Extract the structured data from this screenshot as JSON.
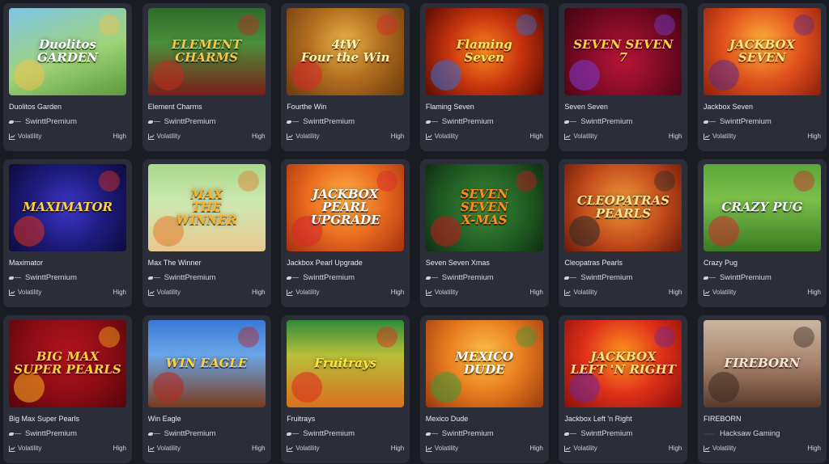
{
  "games": [
    {
      "name": "Duolitos Garden",
      "provider": "SwinttPremium",
      "volatility_label": "Volatility",
      "volatility": "High",
      "art_text": "Duolitos\nGARDEN",
      "bg": "linear-gradient(160deg,#7fc6e8 0%,#9fd37a 55%,#5a9a3b 100%)",
      "fg": "#ffffff",
      "accent": "#f2c14e"
    },
    {
      "name": "Element Charms",
      "provider": "SwinttPremium",
      "volatility_label": "Volatility",
      "volatility": "High",
      "art_text": "ELEMENT CHARMS",
      "bg": "linear-gradient(180deg,#2e6b2c 0%,#4a8f3a 40%,#7a1d1a 100%)",
      "fg": "#f3c64a",
      "accent": "#c22a1e"
    },
    {
      "name": "Fourthe Win",
      "provider": "SwinttPremium",
      "volatility_label": "Volatility",
      "volatility": "High",
      "art_text": "4tW\nFour the Win",
      "bg": "radial-gradient(circle at 50% 40%,#e9b44a 0%,#b4701f 45%,#6b3a0e 100%)",
      "fg": "#fff3b0",
      "accent": "#d8262e"
    },
    {
      "name": "Flaming Seven",
      "provider": "SwinttPremium",
      "volatility_label": "Volatility",
      "volatility": "High",
      "art_text": "Flaming\nSeven",
      "bg": "radial-gradient(circle at 50% 50%,#ff8a1e 0%,#c6330e 50%,#5a0d05 100%)",
      "fg": "#ffe25a",
      "accent": "#2f6fd8"
    },
    {
      "name": "Seven Seven",
      "provider": "SwinttPremium",
      "volatility_label": "Volatility",
      "volatility": "High",
      "art_text": "SEVEN SEVEN\n7",
      "bg": "radial-gradient(circle at 50% 60%,#b71538 0%,#7a0a24 55%,#3d0512 100%)",
      "fg": "#ffd23a",
      "accent": "#7a3bd6"
    },
    {
      "name": "Jackbox Seven",
      "provider": "SwinttPremium",
      "volatility_label": "Volatility",
      "volatility": "High",
      "art_text": "JACKBOX\nSEVEN",
      "bg": "radial-gradient(circle at 50% 40%,#ffb13a 0%,#e0521c 50%,#8e1d0d 100%)",
      "fg": "#ffe27a",
      "accent": "#5a2a8a"
    },
    {
      "name": "Maximator",
      "provider": "SwinttPremium",
      "volatility_label": "Volatility",
      "volatility": "High",
      "art_text": "MAXIMATOR",
      "bg": "radial-gradient(circle at 50% 50%,#3b36c9 0%,#1d1a7a 55%,#0d0b3a 100%)",
      "fg": "#ffd13a",
      "accent": "#e0301e"
    },
    {
      "name": "Max The Winner",
      "provider": "SwinttPremium",
      "volatility_label": "Volatility",
      "volatility": "High",
      "art_text": "MAX\nTHE\nWINNER",
      "bg": "linear-gradient(180deg,#a8d98a 0%,#cfe8b2 45%,#e7c98f 100%)",
      "fg": "#f7b12a",
      "accent": "#e27a2a"
    },
    {
      "name": "Jackbox Pearl Upgrade",
      "provider": "SwinttPremium",
      "volatility_label": "Volatility",
      "volatility": "High",
      "art_text": "JACKBOX\nPEARL\nUPGRADE",
      "bg": "radial-gradient(circle at 50% 40%,#ffb447 0%,#e96a1e 50%,#a3300f 100%)",
      "fg": "#ffffff",
      "accent": "#d8262e"
    },
    {
      "name": "Seven Seven Xmas",
      "provider": "SwinttPremium",
      "volatility_label": "Volatility",
      "volatility": "High",
      "art_text": "SEVEN\nSEVEN\nX-MAS",
      "bg": "radial-gradient(circle at 50% 50%,#3c8c3a 0%,#1f5a22 60%,#0f2f12 100%)",
      "fg": "#ff8a1e",
      "accent": "#c8161e"
    },
    {
      "name": "Cleopatras Pearls",
      "provider": "SwinttPremium",
      "volatility_label": "Volatility",
      "volatility": "High",
      "art_text": "CLEOPATRAS\nPEARLS",
      "bg": "radial-gradient(circle at 50% 45%,#f09a3a 0%,#c24a1a 55%,#6a1a0a 100%)",
      "fg": "#ffe08a",
      "accent": "#2a2a2a"
    },
    {
      "name": "Crazy Pug",
      "provider": "SwinttPremium",
      "volatility_label": "Volatility",
      "volatility": "High",
      "art_text": "CRAZY PUG",
      "bg": "linear-gradient(180deg,#5aa63a 0%,#7cc04a 40%,#3a7a22 100%)",
      "fg": "#f2f2f2",
      "accent": "#d3262e"
    },
    {
      "name": "Big Max Super Pearls",
      "provider": "SwinttPremium",
      "volatility_label": "Volatility",
      "volatility": "High",
      "art_text": "BIG MAX\nSUPER PEARLS",
      "bg": "radial-gradient(circle at 50% 40%,#b3141e 0%,#8a0c14 55%,#55060b 100%)",
      "fg": "#ffd13a",
      "accent": "#ffb020"
    },
    {
      "name": "Win Eagle",
      "provider": "SwinttPremium",
      "volatility_label": "Volatility",
      "volatility": "High",
      "art_text": "WIN EAGLE",
      "bg": "linear-gradient(180deg,#3a78d8 0%,#6aa6e8 40%,#7a3a1a 100%)",
      "fg": "#ffd13a",
      "accent": "#b8261e"
    },
    {
      "name": "Fruitrays",
      "provider": "SwinttPremium",
      "volatility_label": "Volatility",
      "volatility": "High",
      "art_text": "Fruitrays",
      "bg": "linear-gradient(180deg,#2f8a3a 0%,#b8c03a 40%,#d8701e 100%)",
      "fg": "#ffe23a",
      "accent": "#e0261e"
    },
    {
      "name": "Mexico Dude",
      "provider": "SwinttPremium",
      "volatility_label": "Volatility",
      "volatility": "High",
      "art_text": "MEXICO\nDUDE",
      "bg": "radial-gradient(circle at 50% 40%,#ffc24a 0%,#e77a1e 50%,#9a3a0e 100%)",
      "fg": "#ffffff",
      "accent": "#3a9a3a"
    },
    {
      "name": "Jackbox Left 'n Right",
      "provider": "SwinttPremium",
      "volatility_label": "Volatility",
      "volatility": "High",
      "art_text": "JACKBOX\nLEFT 'N RIGHT",
      "bg": "radial-gradient(circle at 50% 40%,#ff9a1e 0%,#e0301a 50%,#8a0f0a 100%)",
      "fg": "#ffe27a",
      "accent": "#6a2a9a"
    },
    {
      "name": "FIREBORN",
      "provider": "Hacksaw Gaming",
      "volatility_label": "Volatility",
      "volatility": "High",
      "art_text": "FIREBORN",
      "bg": "linear-gradient(180deg,#c9b6a0 0%,#a8826a 50%,#5a3a2a 100%)",
      "fg": "#f6e8d8",
      "accent": "#3a2a22"
    }
  ]
}
